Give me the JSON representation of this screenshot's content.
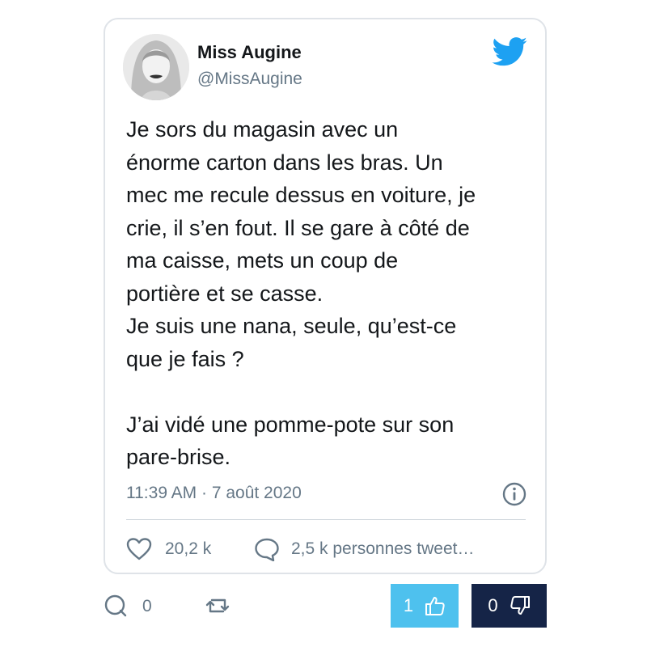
{
  "tweet": {
    "author_name": "Miss Augine",
    "author_handle": "@MissAugine",
    "text": "Je sors du magasin avec un\nénorme carton dans les bras. Un\nmec me recule dessus en voiture, je\ncrie, il s’en fout. Il se gare à côté de\nma caisse, mets un coup de\nportière et se casse.\nJe suis une nana, seule, qu’est-ce\nque je fais ?\n\nJ’ai vidé une pomme-pote sur son\npare-brise.",
    "timestamp": "11:39 AM · 7 août 2020",
    "likes": "20,2 k",
    "retweets": "2,5 k personnes tweet…",
    "icons": {
      "brand": "twitter-bird-icon",
      "info": "info-icon",
      "like": "heart-icon",
      "reply": "speech-bubble-icon"
    }
  },
  "footer": {
    "comment_count": "0",
    "like_count": "1",
    "dislike_count": "0"
  },
  "colors": {
    "twitter_blue": "#1da1f2",
    "like_button": "#4ec1ee",
    "dislike_button": "#152447",
    "secondary_text": "#657786"
  }
}
